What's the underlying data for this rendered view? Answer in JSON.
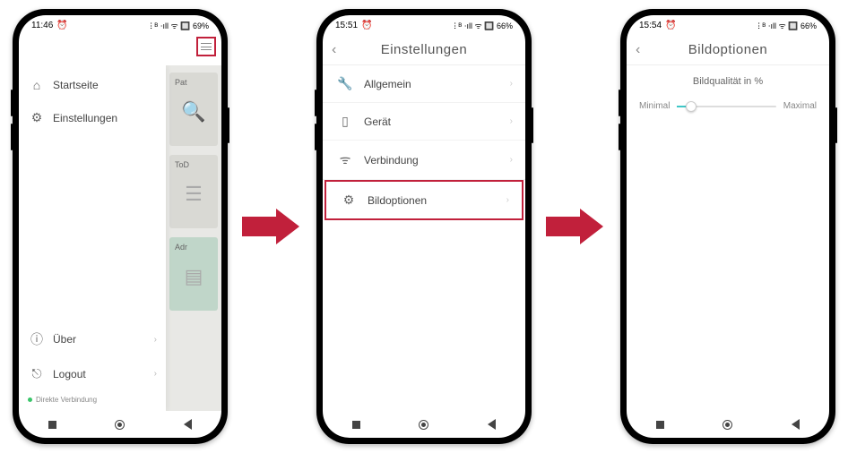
{
  "phone1": {
    "status": {
      "time": "11:46",
      "alarm": "⏰",
      "right": "ⵗ ᴮ ⋅ıll ᯤ 🔲 69%"
    },
    "drawer": {
      "items": [
        {
          "icon": "⌂",
          "label": "Startseite",
          "name": "sidebar-item-home"
        },
        {
          "icon": "⚙",
          "label": "Einstellungen",
          "name": "sidebar-item-settings"
        }
      ],
      "bottom": [
        {
          "icon": "ⓘ",
          "label": "Über",
          "name": "sidebar-item-about"
        },
        {
          "icon": "⏻",
          "label": "Logout",
          "name": "sidebar-item-logout"
        }
      ],
      "status": "Direkte Verbindung"
    },
    "cards": [
      {
        "label": "Pat",
        "name": "card-pat"
      },
      {
        "label": "ToD",
        "name": "card-todo"
      },
      {
        "label": "Adr",
        "name": "card-address"
      }
    ]
  },
  "phone2": {
    "status": {
      "time": "15:51",
      "alarm": "⏰",
      "right": "ⵗ ᴮ ⋅ıll ᯤ 🔲 66%"
    },
    "title": "Einstellungen",
    "items": [
      {
        "icon": "🔧",
        "label": "Allgemein",
        "name": "settings-item-general",
        "hl": false
      },
      {
        "icon": "▯",
        "label": "Gerät",
        "name": "settings-item-device",
        "hl": false
      },
      {
        "icon": "ᯤ",
        "label": "Verbindung",
        "name": "settings-item-connection",
        "hl": false
      },
      {
        "icon": "⚙",
        "label": "Bildoptionen",
        "name": "settings-item-image-options",
        "hl": true
      }
    ]
  },
  "phone3": {
    "status": {
      "time": "15:54",
      "alarm": "⏰",
      "right": "ⵗ ᴮ ⋅ıll ᯤ 🔲 66%"
    },
    "title": "Bildoptionen",
    "quality_label": "Bildqualität in %",
    "slider": {
      "min_label": "Minimal",
      "max_label": "Maximal"
    }
  }
}
